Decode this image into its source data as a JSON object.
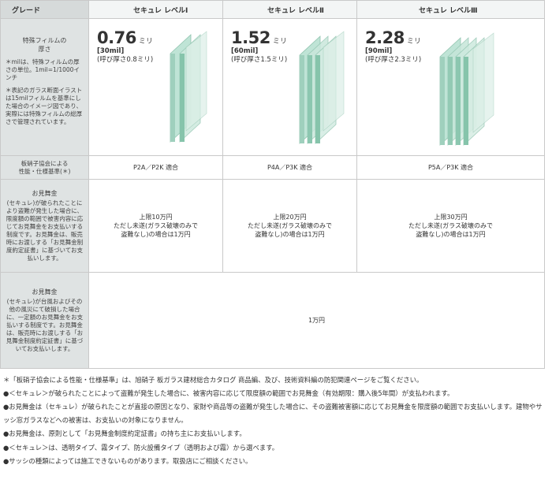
{
  "header": {
    "grade": "グレード",
    "levels": [
      "セキュレ レベルⅠ",
      "セキュレ レベルⅡ",
      "セキュレ レベルⅢ"
    ]
  },
  "row1": {
    "title_line1": "特殊フィルムの",
    "title_line2": "厚さ",
    "note1": "＊milは、特殊フィルムの厚さの単位。1mil=1/1000インチ",
    "note2": "＊表記のガラス断面イラストは15milフィルムを基準にした場合のイメージ図であり、実際には特殊フィルムの総厚さで管理されています。",
    "cells": [
      {
        "value": "0.76",
        "unit": "ミリ",
        "mil": "[30mil]",
        "yobi": "(呼び厚さ0.8ミリ)"
      },
      {
        "value": "1.52",
        "unit": "ミリ",
        "mil": "[60mil]",
        "yobi": "(呼び厚さ1.5ミリ)"
      },
      {
        "value": "2.28",
        "unit": "ミリ",
        "mil": "[90mil]",
        "yobi": "(呼び厚さ2.3ミリ)"
      }
    ]
  },
  "row2": {
    "title_line1": "板硝子協会による",
    "title_line2": "性能・仕様基準(＊)",
    "cells": [
      "P2A／P2K 適合",
      "P4A／P3K 適合",
      "P5A／P3K 適合"
    ]
  },
  "row3": {
    "title": "お見舞金",
    "desc": "(セキュレ)が破られたことにより盗難が発生した場合に、限度額の範囲で被害内容に応じてお見舞金をお支払いする制度です。お見舞金は、販売時にお渡しする「お見舞金制度約定証書」に基づいてお支払いします。",
    "cells": [
      {
        "l1": "上限10万円",
        "l2": "ただし未遂(ガラス破壊のみで",
        "l3": "盗難なし)の場合は1万円"
      },
      {
        "l1": "上限20万円",
        "l2": "ただし未遂(ガラス破壊のみで",
        "l3": "盗難なし)の場合は1万円"
      },
      {
        "l1": "上限30万円",
        "l2": "ただし未遂(ガラス破壊のみで",
        "l3": "盗難なし)の場合は1万円"
      }
    ]
  },
  "row4": {
    "title": "お見舞金",
    "desc": "(セキュレ)が台風およびその他の風災にて破損した場合に、一定額のお見舞金をお支払いする制度です。お見舞金は、販売時にお渡しする「お見舞金制度約定証書」に基づいてお支払いします。",
    "value": "1万円"
  },
  "notes": [
    "＊「板硝子協会による性能・仕様基準」は、旭硝子 板ガラス建材総合カタログ 商品編、及び、技術資料編の防犯関連ページをご覧ください。",
    "●＜セキュレ＞が破られたことによって盗難が発生した場合に、被害内容に応じて限度額の範囲でお見舞金（有効期限：購入後5年間）が支払われます。",
    "●お見舞金は（セキュレ）が破られたことが直接の原因となり、家財や商品等の盗難が発生した場合に、その盗難被害額に応じてお見舞金を限度額の範囲でお支払いします。建物やサッシ窓ガラスなどへの被害は、お支払いの対象になりません。",
    "●お見舞金は、原則として「お見舞金制度約定証書」の持ち主にお支払いします。",
    "●＜セキュレ＞は、透明タイプ、霧タイプ、防火設備タイプ（透明および霧）から選べます。",
    "●サッシの種類によっては施工できないものがあります。取扱店にご相談ください。"
  ],
  "colors": {
    "label_bg": "#dfe3e3",
    "border": "#c9c9c9",
    "glass": "#a9d8c6"
  },
  "icons": [
    "glass-section-icon"
  ]
}
